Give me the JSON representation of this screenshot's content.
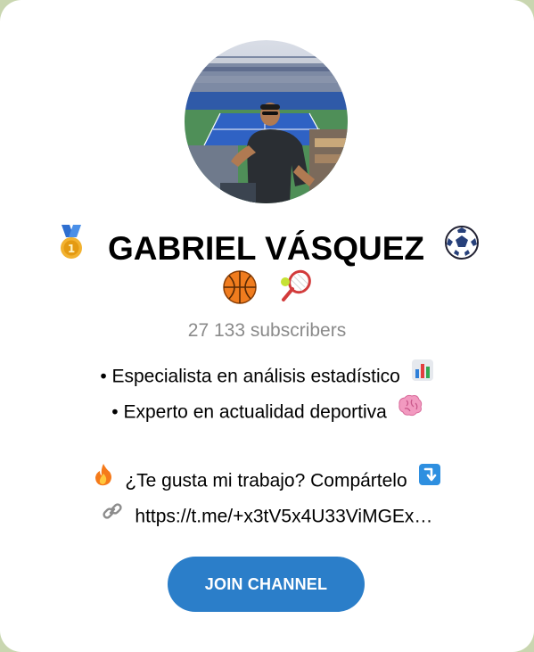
{
  "channel": {
    "name": "GABRIEL VÁSQUEZ",
    "subscribers": "27 133 subscribers",
    "title_icons": [
      "medal-icon",
      "soccer-ball-icon"
    ],
    "extra_icons": [
      "basketball-icon",
      "tennis-icon"
    ],
    "description": {
      "line1": "• Especialista en análisis estadístico",
      "line1_icon": "bar-chart-icon",
      "line2": "• Experto en actualidad deportiva",
      "line2_icon": "brain-icon",
      "line3": "¿Te gusta mi trabajo? Compártelo",
      "line3_icons": [
        "fire-icon",
        "arrow-down-icon"
      ],
      "line4": "https://t.me/+x3tV5x4U33ViMGEx…",
      "line4_icon": "link-icon"
    },
    "join_label": "JOIN CHANNEL"
  },
  "colors": {
    "accent": "#2b7ec9",
    "subscribers_text": "#8a8a8a",
    "background": "#c9d6b0"
  }
}
